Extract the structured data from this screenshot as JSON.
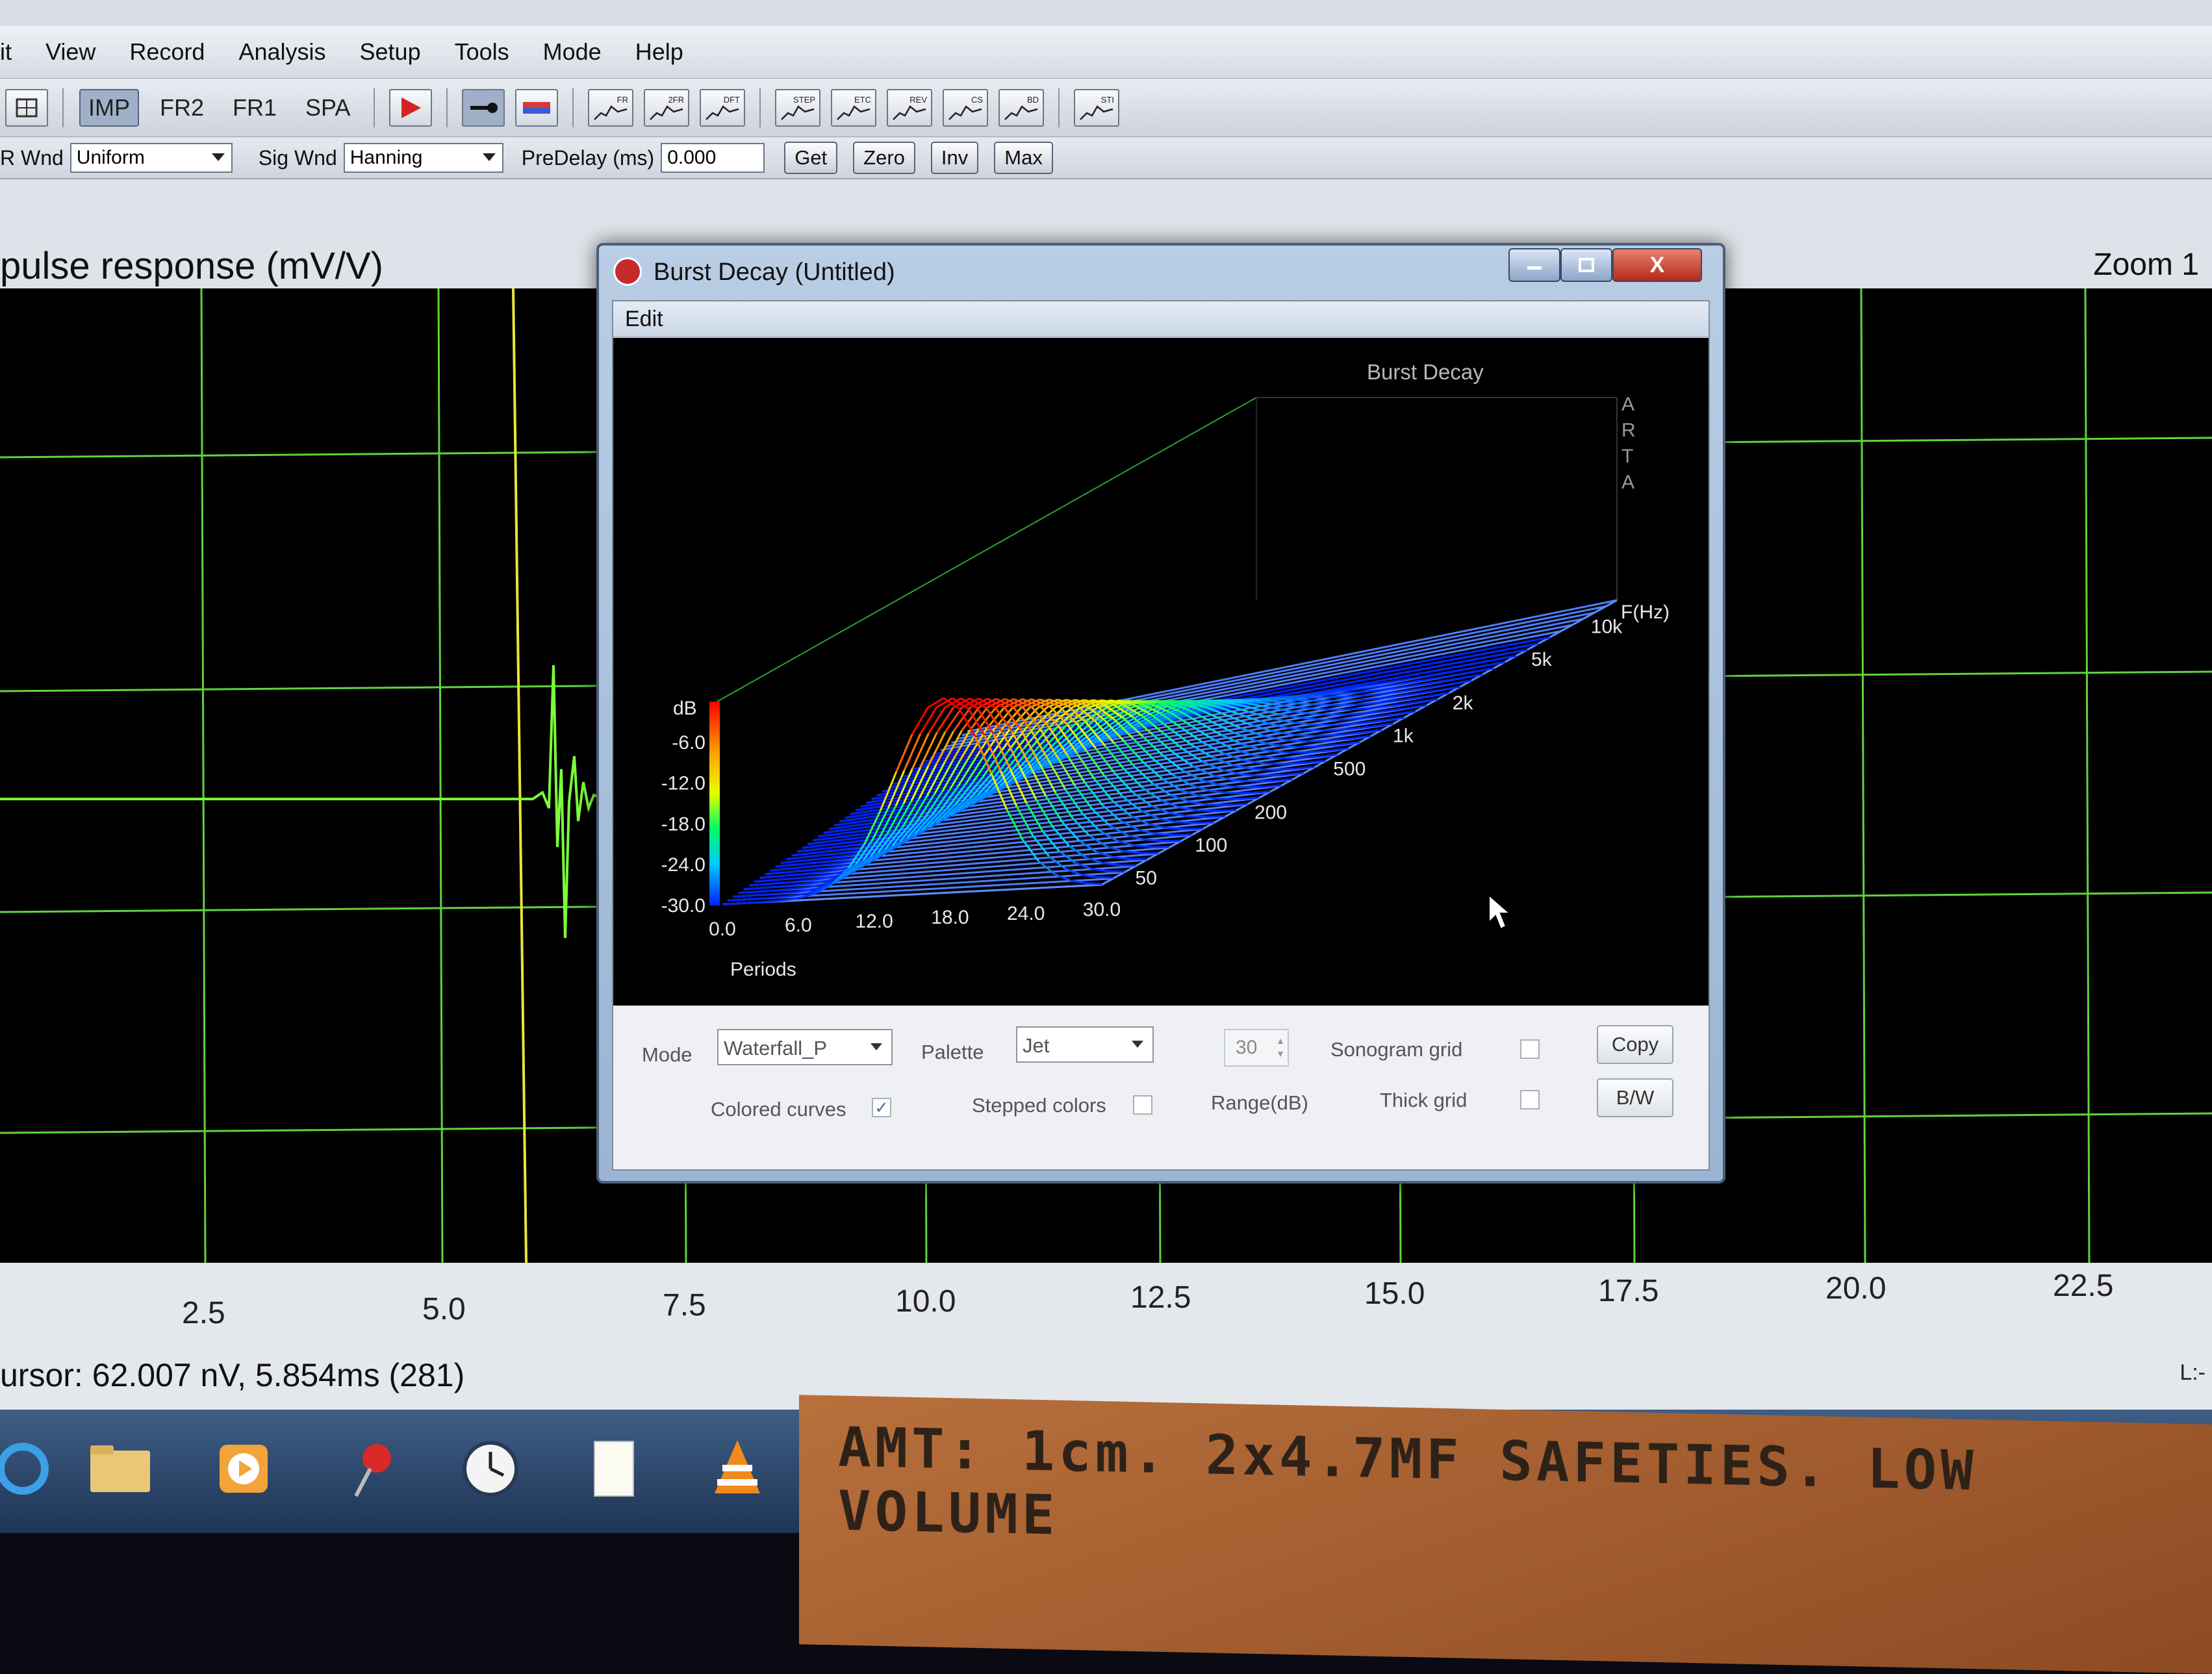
{
  "menu": [
    "it",
    "View",
    "Record",
    "Analysis",
    "Setup",
    "Tools",
    "Mode",
    "Help"
  ],
  "toolbar1": {
    "mode_buttons": [
      "IMP",
      "FR2",
      "FR1",
      "SPA"
    ],
    "icon_buttons": [
      "FR",
      "2FR",
      "DFT",
      "STEP",
      "ETC",
      "REV",
      "CS",
      "BD",
      "STI"
    ]
  },
  "toolbar2": {
    "ir_wnd_label": "R Wnd",
    "ir_wnd_value": "Uniform",
    "sig_wnd_label": "Sig Wnd",
    "sig_wnd_value": "Hanning",
    "predelay_label": "PreDelay (ms)",
    "predelay_value": "0.000",
    "buttons": [
      "Get",
      "Zero",
      "Inv",
      "Max"
    ]
  },
  "graph": {
    "title": "pulse response (mV/V)",
    "zoom_label": "Zoom 1",
    "x_ticks": [
      "2.5",
      "5.0",
      "7.5",
      "10.0",
      "12.5",
      "15.0",
      "17.5",
      "20.0",
      "22.5"
    ],
    "cursor_readout": "ursor: 62.007 nV, 5.854ms (281)",
    "status_corner": "L:-"
  },
  "dialog": {
    "title": "Burst Decay  (Untitled)",
    "menu_edit": "Edit",
    "close_glyph": "X",
    "controls": {
      "mode_label": "Mode",
      "mode_value": "Waterfall_P",
      "palette_label": "Palette",
      "palette_value": "Jet",
      "range_value": "30",
      "range_label": "Range(dB)",
      "sonogram_grid_label": "Sonogram grid",
      "thick_grid_label": "Thick grid",
      "colored_curves_label": "Colored curves",
      "stepped_colors_label": "Stepped colors",
      "copy_label": "Copy",
      "bw_label": "B/W"
    }
  },
  "chart_data": {
    "type": "waterfall",
    "title": "Burst Decay",
    "side_label": "ARTA",
    "xlabel": "Periods",
    "x_ticks": [
      "0.0",
      "6.0",
      "12.0",
      "18.0",
      "24.0",
      "30.0"
    ],
    "ylabel": "dB",
    "y_ticks": [
      "-6.0",
      "-12.0",
      "-18.0",
      "-24.0",
      "-30.0"
    ],
    "zlabel": "F(Hz)",
    "z_ticks": [
      "50",
      "100",
      "200",
      "500",
      "1k",
      "2k",
      "5k",
      "10k"
    ],
    "xlim": [
      0,
      30
    ],
    "ylim": [
      -30,
      0
    ],
    "palette": "Jet",
    "note": ""
  },
  "note": {
    "text": "AMT: 1cm. 2x4.7MF SAFETIES. LOW VOLUME"
  },
  "colors": {
    "plot_background": "#000000",
    "grid": "#5fd43c",
    "impulse_trace": "#7cff3a",
    "cursor_line": "#e6e63a",
    "waterfall_floor": "#4f7dff"
  }
}
